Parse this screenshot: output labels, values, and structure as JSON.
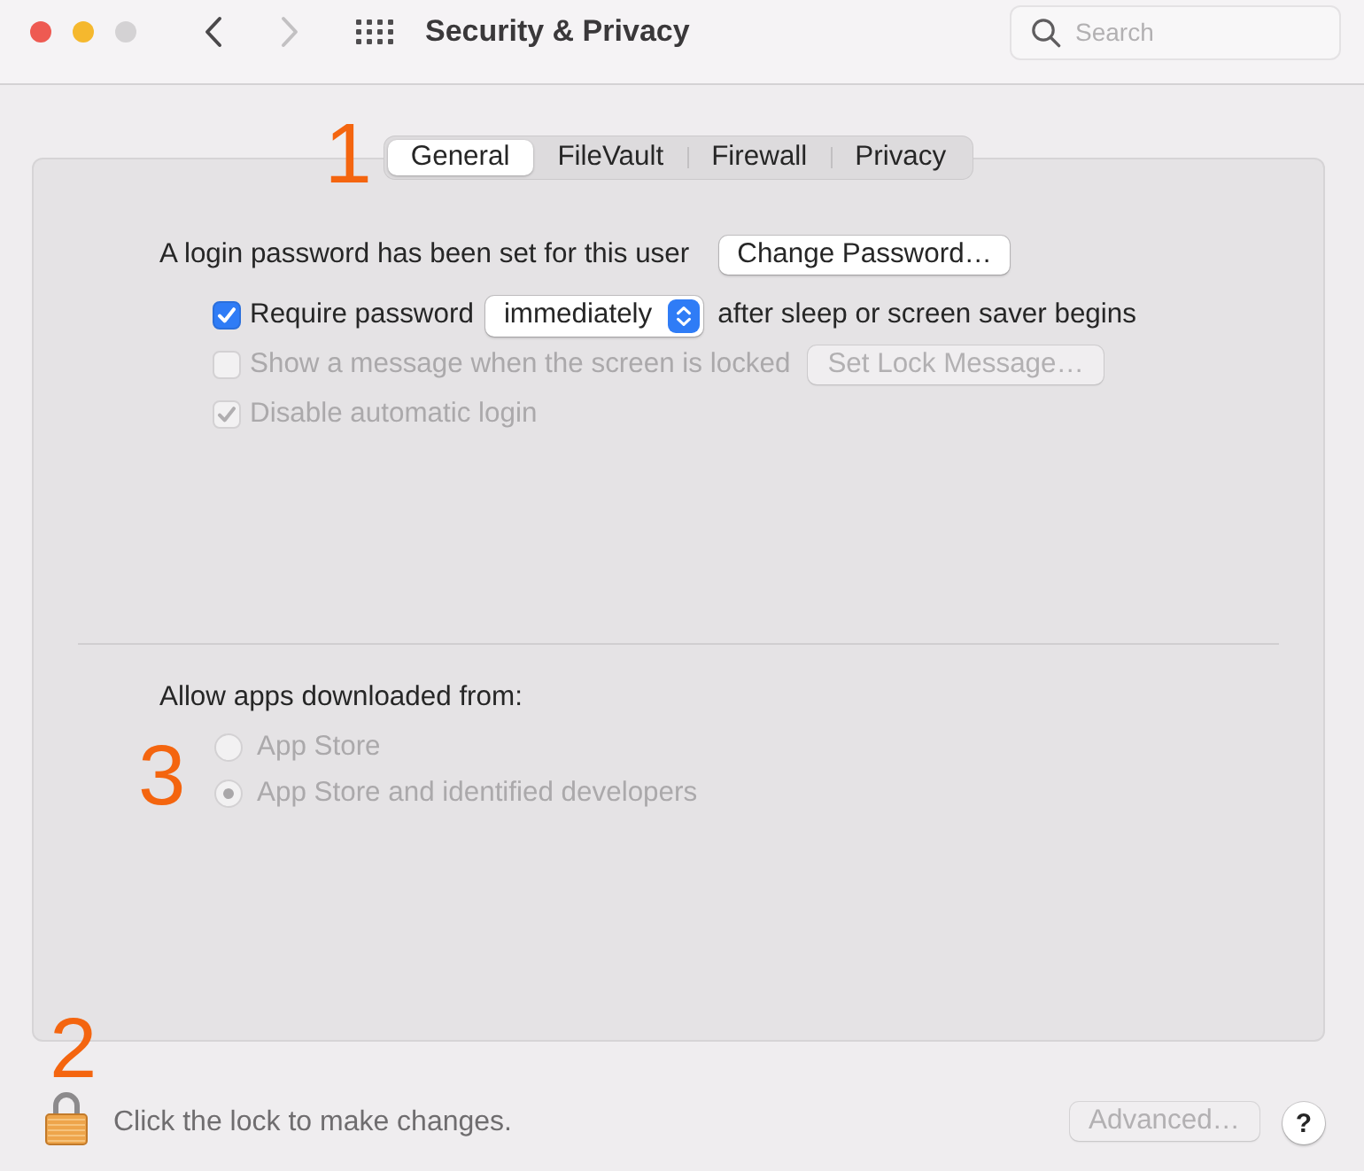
{
  "window": {
    "title": "Security & Privacy"
  },
  "window_controls": [
    {
      "kind": "close",
      "disabled": false
    },
    {
      "kind": "minimize",
      "disabled": false
    },
    {
      "kind": "zoom",
      "disabled": true
    }
  ],
  "navigation": [
    {
      "kind": "back",
      "disabled": false
    },
    {
      "kind": "forward",
      "disabled": true
    }
  ],
  "search": {
    "placeholder": "Search"
  },
  "tab_bar": {
    "annotation": "1",
    "tabs": [
      {
        "label": "General",
        "selected": true
      },
      {
        "label": "FileVault",
        "selected": false
      },
      {
        "label": "Firewall",
        "selected": false
      },
      {
        "label": "Privacy",
        "selected": false
      }
    ]
  },
  "general": {
    "login_text": "A login password has been set for this user",
    "change_password_button": {
      "label": "Change Password…",
      "disabled": false
    },
    "options": [
      {
        "label": "Require password",
        "checked": true,
        "disabled": false,
        "popup": {
          "value": "immediately"
        },
        "suffix": "after sleep or screen saver begins"
      },
      {
        "label": "Show a message when the screen is locked",
        "checked": false,
        "disabled": true,
        "button": {
          "label": "Set Lock Message…",
          "disabled": true
        }
      },
      {
        "label": "Disable automatic login",
        "checked": true,
        "disabled": true
      }
    ]
  },
  "gatekeeper": {
    "heading": "Allow apps downloaded from:",
    "annotation": "3",
    "choices": [
      {
        "label": "App Store",
        "selected": false,
        "disabled": true
      },
      {
        "label": "App Store and identified developers",
        "selected": true,
        "disabled": true
      }
    ]
  },
  "footer": {
    "annotation": "2",
    "locked": true,
    "lock_text": "Click the lock to make changes.",
    "advanced_button": {
      "label": "Advanced…",
      "disabled": true
    },
    "help_button": {
      "label": "?"
    }
  }
}
